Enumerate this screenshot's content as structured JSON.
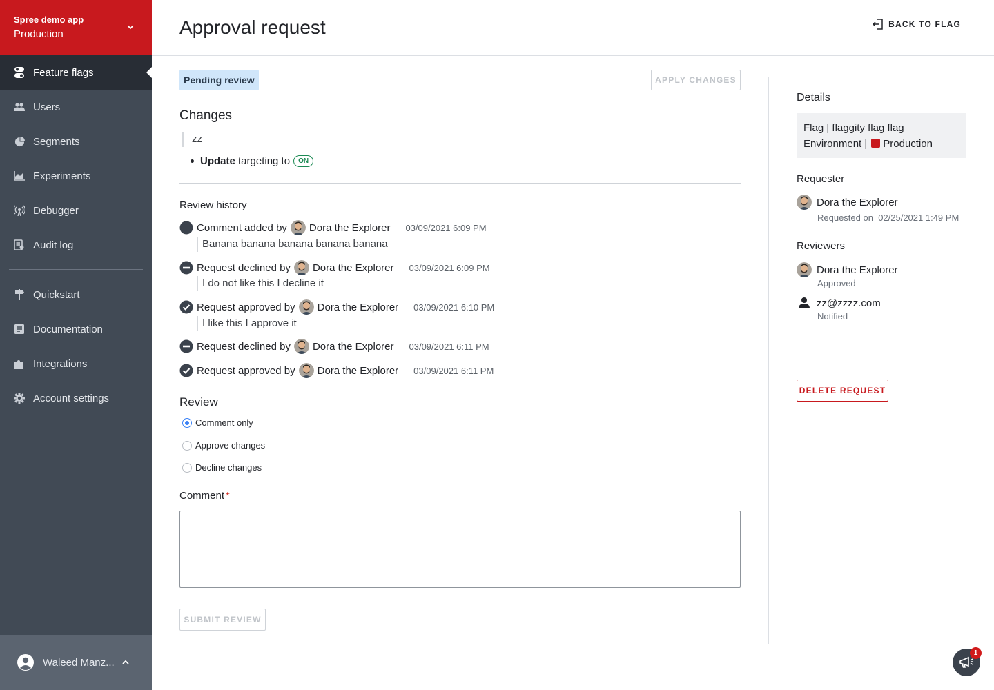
{
  "project": {
    "name": "Spree demo app",
    "environment": "Production"
  },
  "sidebar": {
    "items": [
      {
        "label": "Feature flags",
        "icon": "toggle-icon"
      },
      {
        "label": "Users",
        "icon": "users-icon"
      },
      {
        "label": "Segments",
        "icon": "pie-icon"
      },
      {
        "label": "Experiments",
        "icon": "chart-icon"
      },
      {
        "label": "Debugger",
        "icon": "broadcast-icon"
      },
      {
        "label": "Audit log",
        "icon": "audit-icon"
      }
    ],
    "secondary": [
      {
        "label": "Quickstart",
        "icon": "signpost-icon"
      },
      {
        "label": "Documentation",
        "icon": "doc-icon"
      },
      {
        "label": "Integrations",
        "icon": "puzzle-icon"
      },
      {
        "label": "Account settings",
        "icon": "gear-icon"
      }
    ],
    "user": "Waleed Manz..."
  },
  "header": {
    "title": "Approval request",
    "back_label": "BACK TO FLAG"
  },
  "status_badge": "Pending review",
  "apply_label": "APPLY CHANGES",
  "changes": {
    "title": "Changes",
    "description": "zz",
    "action": "Update",
    "target": "targeting to",
    "state": "ON"
  },
  "review_history": {
    "title": "Review history",
    "entries": [
      {
        "type": "comment",
        "action": "Comment added by",
        "user": "Dora the Explorer",
        "time": "03/09/2021 6:09 PM",
        "note": "Banana banana banana banana banana"
      },
      {
        "type": "declined",
        "action": "Request declined by",
        "user": "Dora the Explorer",
        "time": "03/09/2021 6:09 PM",
        "note": "I do not like this I decline it"
      },
      {
        "type": "approved",
        "action": "Request approved by",
        "user": "Dora the Explorer",
        "time": "03/09/2021 6:10 PM",
        "note": "I like this I approve it"
      },
      {
        "type": "declined",
        "action": "Request declined by",
        "user": "Dora the Explorer",
        "time": "03/09/2021 6:11 PM",
        "note": ""
      },
      {
        "type": "approved",
        "action": "Request approved by",
        "user": "Dora the Explorer",
        "time": "03/09/2021 6:11 PM",
        "note": ""
      }
    ]
  },
  "review": {
    "title": "Review",
    "options": [
      "Comment only",
      "Approve changes",
      "Decline changes"
    ],
    "selected": "Comment only",
    "comment_label": "Comment",
    "required_mark": "*",
    "comment_value": "",
    "submit_label": "SUBMIT REVIEW"
  },
  "details": {
    "title": "Details",
    "flag_line": "Flag | flaggity flag flag",
    "env_prefix": "Environment |",
    "env_name": "Production",
    "env_color": "#c8191e"
  },
  "requester": {
    "title": "Requester",
    "name": "Dora the Explorer",
    "requested_label": "Requested on",
    "requested_on": "02/25/2021 1:49 PM"
  },
  "reviewers": {
    "title": "Reviewers",
    "list": [
      {
        "name": "Dora the Explorer",
        "status": "Approved"
      },
      {
        "name": "zz@zzzz.com",
        "status": "Notified"
      }
    ]
  },
  "delete_label": "DELETE REQUEST",
  "notifications": {
    "count": "1"
  },
  "colors": {
    "brand": "#c8191e",
    "sidebar": "#414a55",
    "sidebar_active": "#282d35",
    "accent": "#3b82f6"
  }
}
